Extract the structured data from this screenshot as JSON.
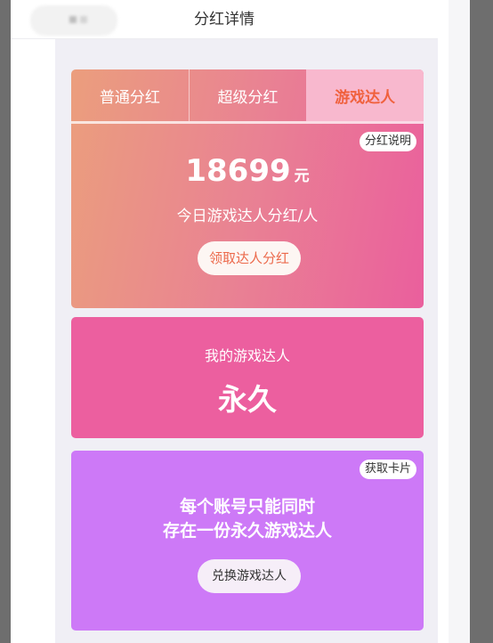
{
  "header": {
    "title": "分红详情"
  },
  "tabs": [
    {
      "label": "普通分红",
      "active": false
    },
    {
      "label": "超级分红",
      "active": false
    },
    {
      "label": "游戏达人",
      "active": true
    }
  ],
  "dividend": {
    "explain_label": "分红说明",
    "amount": "18699",
    "unit": "元",
    "description": "今日游戏达人分红/人",
    "claim_label": "领取达人分红"
  },
  "my_status": {
    "label": "我的游戏达人",
    "value": "永久"
  },
  "card_section": {
    "get_card_label": "获取卡片",
    "notice_line1": "每个账号只能同时",
    "notice_line2": "存在一份永久游戏达人",
    "exchange_label": "兑换游戏达人"
  },
  "colors": {
    "active_tab_bg": "#f8b8ce",
    "active_tab_text": "#f0613e",
    "mid_card": "#ec5f9f",
    "bottom_card": "#cd79f7"
  }
}
